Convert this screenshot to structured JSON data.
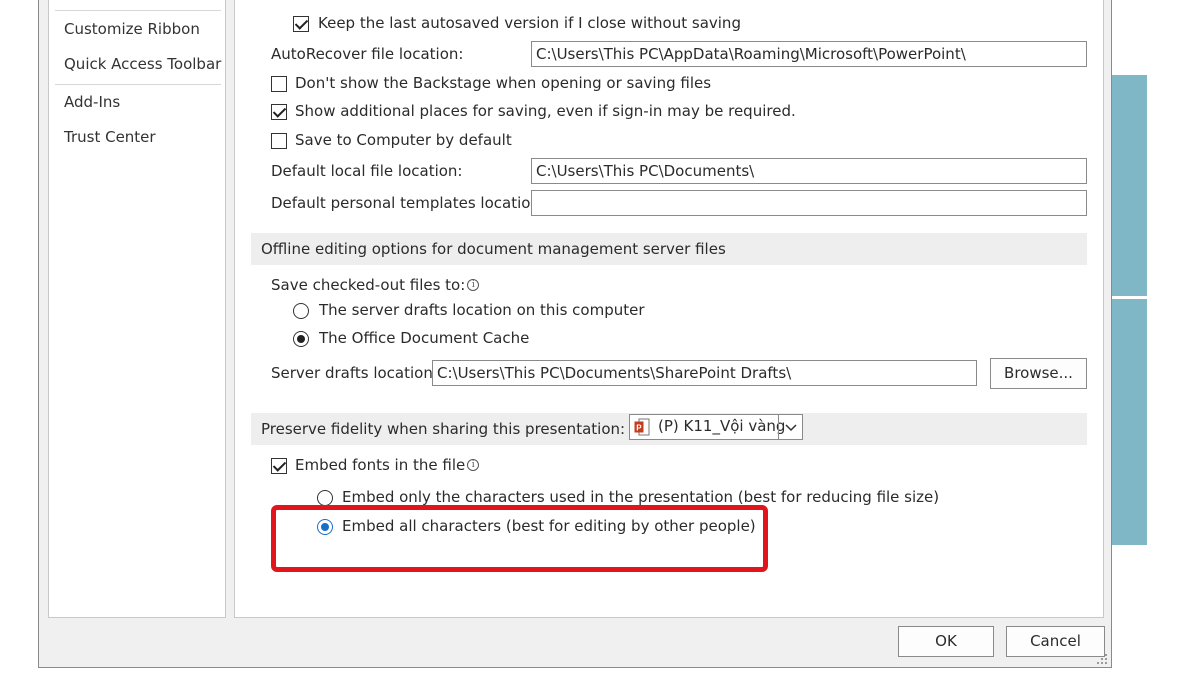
{
  "nav": {
    "items": [
      {
        "id": "customize-ribbon",
        "label": "Customize Ribbon"
      },
      {
        "id": "quick-access-toolbar",
        "label": "Quick Access Toolbar"
      },
      {
        "id": "add-ins",
        "label": "Add-Ins"
      },
      {
        "id": "trust-center",
        "label": "Trust Center"
      }
    ]
  },
  "save": {
    "keep_last_autosaved_label": "Keep the last autosaved version if I close without saving",
    "keep_last_autosaved_checked": true,
    "autorecover_label": "AutoRecover file location:",
    "autorecover_value": "C:\\Users\\This PC\\AppData\\Roaming\\Microsoft\\PowerPoint\\",
    "dont_show_backstage_label": "Don't show the Backstage when opening or saving files",
    "dont_show_backstage_checked": false,
    "show_additional_places_label": "Show additional places for saving, even if sign-in may be required.",
    "show_additional_places_checked": true,
    "save_to_computer_label": "Save to Computer by default",
    "save_to_computer_checked": false,
    "default_local_label": "Default local file location:",
    "default_local_value": "C:\\Users\\This PC\\Documents\\",
    "default_templates_label": "Default personal templates location:",
    "default_templates_value": ""
  },
  "offline": {
    "section_title": "Offline editing options for document management server files",
    "save_checked_out_label": "Save checked-out files to:",
    "radio_server_label": "The server drafts location on this computer",
    "radio_cache_label": "The Office Document Cache",
    "selected": "cache",
    "server_drafts_label": "Server drafts location:",
    "server_drafts_value": "C:\\Users\\This PC\\Documents\\SharePoint Drafts\\",
    "browse_label": "Browse..."
  },
  "fidelity": {
    "section_title": "Preserve fidelity when sharing this presentation:",
    "presentation_value": "(P) K11_Vội vàng",
    "embed_fonts_label": "Embed fonts in the file",
    "embed_fonts_checked": true,
    "embed_only_label": "Embed only the characters used in the presentation (best for reducing file size)",
    "embed_all_label": "Embed all characters (best for editing by other people)",
    "selected": "embed_all"
  },
  "footer": {
    "ok_label": "OK",
    "cancel_label": "Cancel"
  },
  "colors": {
    "highlight": "#e0161c",
    "accent": "#7fb7c7",
    "radio_selected": "#1a6fc9"
  }
}
